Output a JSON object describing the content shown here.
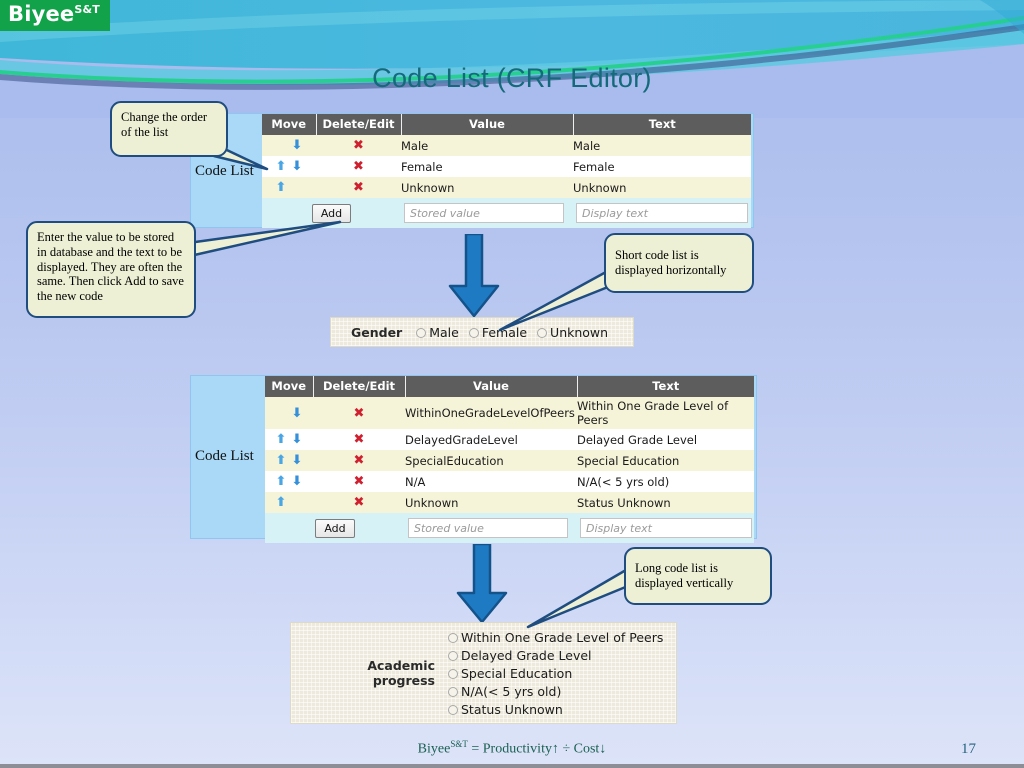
{
  "logo": {
    "name": "Biyee",
    "sup": "S&T"
  },
  "slide": {
    "title": "Code List (CRF Editor)",
    "footer_text": "Biyee",
    "footer_sup": "S&T",
    "footer_rest": " = Productivity↑ ÷ Cost↓",
    "page_number": "17"
  },
  "callouts": {
    "order": "Change the order of the list",
    "enter": "Enter the value to be stored in database and the text to be displayed. They are often the same. Then click Add to save the new code",
    "short": "Short code list is displayed horizontally",
    "long": "Long code list is displayed vertically"
  },
  "code_list_1": {
    "panel_label": "Code List",
    "headers": [
      "Move",
      "Delete/Edit",
      "Value",
      "Text"
    ],
    "rows": [
      {
        "up": "",
        "down": "⬇",
        "del": "✖",
        "value": "Male",
        "text": "Male"
      },
      {
        "up": "⬆",
        "down": "⬇",
        "del": "✖",
        "value": "Female",
        "text": "Female"
      },
      {
        "up": "⬆",
        "down": "",
        "del": "✖",
        "value": "Unknown",
        "text": "Unknown"
      }
    ],
    "add_label": "Add",
    "value_placeholder": "Stored value",
    "text_placeholder": "Display text"
  },
  "code_list_2": {
    "panel_label": "Code List",
    "headers": [
      "Move",
      "Delete/Edit",
      "Value",
      "Text"
    ],
    "rows": [
      {
        "up": "",
        "down": "⬇",
        "del": "✖",
        "value": "WithinOneGradeLevelOfPeers",
        "text": "Within One Grade Level of Peers"
      },
      {
        "up": "⬆",
        "down": "⬇",
        "del": "✖",
        "value": "DelayedGradeLevel",
        "text": "Delayed Grade Level"
      },
      {
        "up": "⬆",
        "down": "⬇",
        "del": "✖",
        "value": "SpecialEducation",
        "text": "Special Education"
      },
      {
        "up": "⬆",
        "down": "⬇",
        "del": "✖",
        "value": "N/A",
        "text": "N/A(< 5 yrs old)"
      },
      {
        "up": "⬆",
        "down": "",
        "del": "✖",
        "value": "Unknown",
        "text": "Status Unknown"
      }
    ],
    "add_label": "Add",
    "value_placeholder": "Stored value",
    "text_placeholder": "Display text"
  },
  "gender_form": {
    "label": "Gender",
    "options": [
      "Male",
      "Female",
      "Unknown"
    ]
  },
  "academic_form": {
    "label": "Academic progress",
    "options": [
      "Within One Grade Level of Peers",
      "Delayed Grade Level",
      "Special Education",
      "N/A(< 5 yrs old)",
      "Status Unknown"
    ]
  },
  "colors": {
    "header_bg": "#5d5d5d",
    "panel_blue": "#a9d9f7",
    "row_odd": "#f5f3d8",
    "add_row": "#d6f2f6",
    "arrow_blue": "#3490db",
    "delete_red": "#cf2030",
    "callout_bg": "#edf0d4",
    "callout_border": "#1f4d80",
    "title_teal": "#146a7a",
    "logo_green": "#12a34a",
    "form_beige": "#eeeadb"
  }
}
